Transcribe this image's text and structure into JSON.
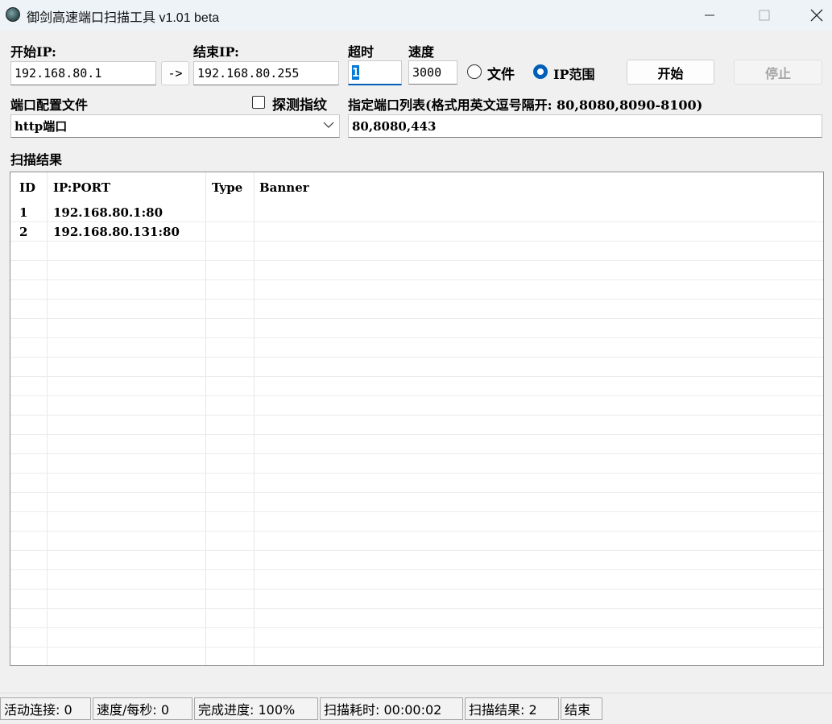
{
  "window": {
    "title": "御剑高速端口扫描工具 v1.01 beta",
    "icon": "app-icon"
  },
  "form": {
    "start_ip_label": "开始IP:",
    "start_ip_value": "192.168.80.1",
    "arrow_button": "->",
    "end_ip_label": "结束IP:",
    "end_ip_value": "192.168.80.255",
    "timeout_label": "超时",
    "timeout_value": "1",
    "speed_label": "速度",
    "speed_value": "3000",
    "radio_file_label": "文件",
    "radio_file_selected": false,
    "radio_iprange_label": "IP范围",
    "radio_iprange_selected": true,
    "start_button": "开始",
    "stop_button": "停止",
    "port_profile_label": "端口配置文件",
    "fingerprint_label": "探测指纹",
    "fingerprint_checked": false,
    "port_profile_value": "http端口",
    "port_list_label": "指定端口列表(格式用英文逗号隔开: 80,8080,8090-8100)",
    "port_list_value": "80,8080,443"
  },
  "results": {
    "title": "扫描结果",
    "columns": [
      "ID",
      "IP:PORT",
      "Type",
      "Banner"
    ],
    "rows": [
      {
        "id": "1",
        "ip_port": "192.168.80.1:80",
        "type": "",
        "banner": ""
      },
      {
        "id": "2",
        "ip_port": "192.168.80.131:80",
        "type": "",
        "banner": ""
      }
    ]
  },
  "status": {
    "active_connections": "活动连接: 0",
    "speed_per_sec": "速度/每秒: 0",
    "progress": "完成进度: 100%",
    "elapsed": "扫描耗时: 00:00:02",
    "result_count": "扫描结果: 2",
    "state": "结束"
  },
  "colors": {
    "accent": "#005fb8",
    "titlebar_bg": "#eef3f8",
    "window_bg": "#f0f0f0"
  }
}
